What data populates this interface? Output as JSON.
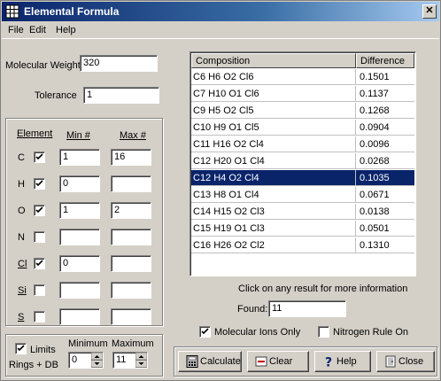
{
  "window": {
    "title": "Elemental Formula",
    "close_glyph": "✕"
  },
  "menu": [
    "File",
    "Edit",
    "Help"
  ],
  "molecular_weight": {
    "label": "Molecular Weight",
    "value": "320"
  },
  "tolerance": {
    "label": "Tolerance",
    "value": "1"
  },
  "elements_header": {
    "element": "Element",
    "min": "Min #",
    "max": "Max #"
  },
  "elements": [
    {
      "symbol": "C",
      "checked": true,
      "min": "1",
      "max": "16"
    },
    {
      "symbol": "H",
      "checked": true,
      "min": "0",
      "max": ""
    },
    {
      "symbol": "O",
      "checked": true,
      "min": "1",
      "max": "2"
    },
    {
      "symbol": "N",
      "checked": false,
      "min": "",
      "max": ""
    },
    {
      "symbol": "Cl",
      "checked": true,
      "min": "0",
      "max": ""
    },
    {
      "symbol": "Si",
      "checked": false,
      "min": "",
      "max": ""
    },
    {
      "symbol": "S",
      "checked": false,
      "min": "",
      "max": ""
    }
  ],
  "limits": {
    "label": "Limits",
    "sublabel": "Rings + DB",
    "checked": true,
    "min_label": "Minimum",
    "max_label": "Maximum",
    "min_value": "0",
    "max_value": "11"
  },
  "results": {
    "col_composition": "Composition",
    "col_difference": "Difference",
    "rows": [
      {
        "composition": "C6 H6 O2 Cl6",
        "difference": "0.1501"
      },
      {
        "composition": "C7 H10 O1 Cl6",
        "difference": "0.1137"
      },
      {
        "composition": "C9 H5 O2 Cl5",
        "difference": "0.1268"
      },
      {
        "composition": "C10 H9 O1 Cl5",
        "difference": "0.0904"
      },
      {
        "composition": "C11 H16 O2 Cl4",
        "difference": "0.0096"
      },
      {
        "composition": "C12 H20 O1 Cl4",
        "difference": "0.0268"
      },
      {
        "composition": "C12 H4 O2 Cl4",
        "difference": "0.1035"
      },
      {
        "composition": "C13 H8 O1 Cl4",
        "difference": "0.0671"
      },
      {
        "composition": "C14 H15 O2 Cl3",
        "difference": "0.0138"
      },
      {
        "composition": "C15 H19 O1 Cl3",
        "difference": "0.0501"
      },
      {
        "composition": "C16 H26 O2 Cl2",
        "difference": "0.1310"
      }
    ],
    "selected_index": 6
  },
  "hint": "Click on any result for more information",
  "found": {
    "label": "Found:",
    "value": "11"
  },
  "options": {
    "molecular_ions": {
      "label": "Molecular Ions Only",
      "checked": true
    },
    "nitrogen_rule": {
      "label": "Nitrogen Rule On",
      "checked": false
    }
  },
  "buttons": {
    "calculate": "Calculate",
    "clear": "Clear",
    "help": "Help",
    "close": "Close"
  },
  "colors": {
    "selection": "#0a246a",
    "face": "#d4d0c8",
    "title_start": "#0a246a"
  }
}
